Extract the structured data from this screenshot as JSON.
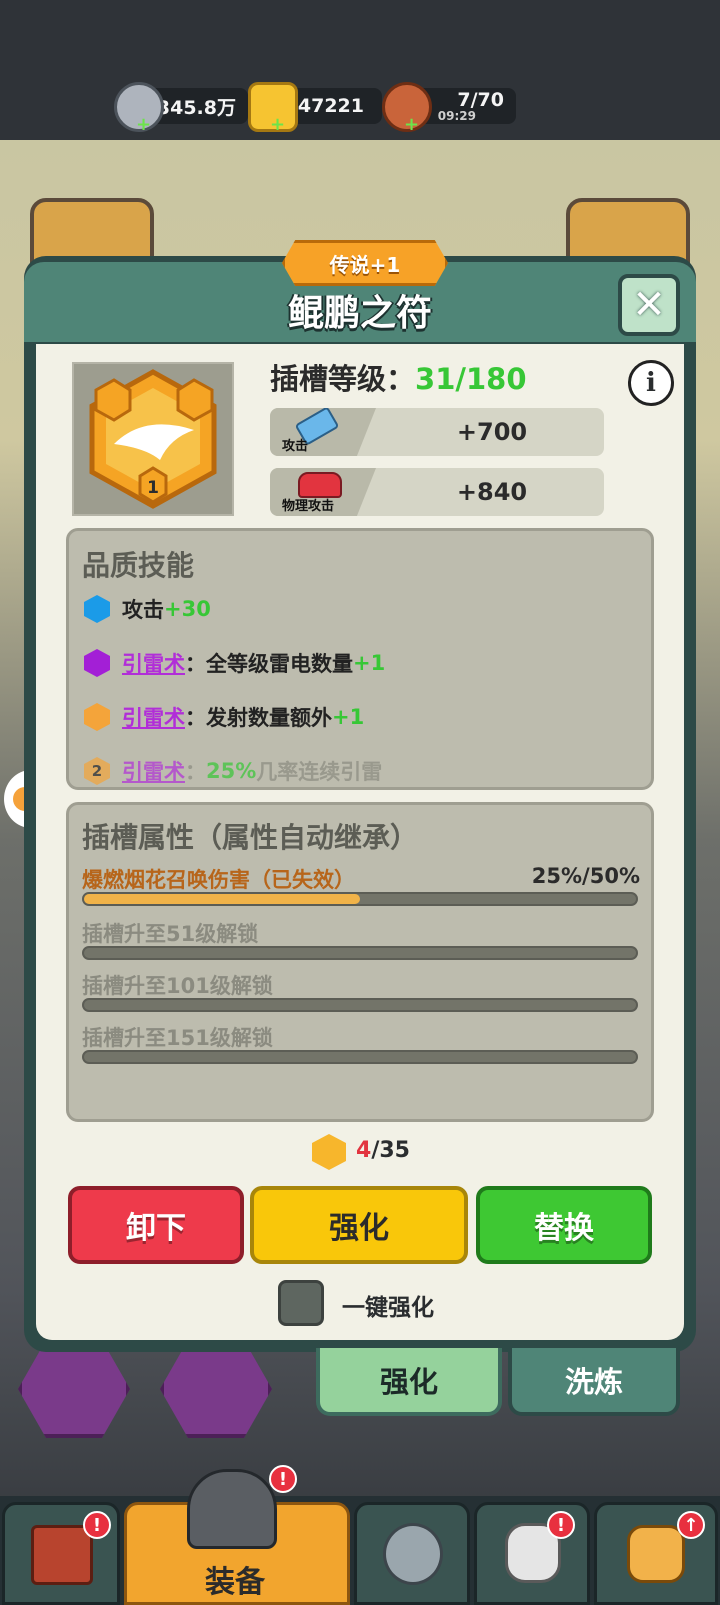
{
  "currency": {
    "silver": "3345.8万",
    "gold": "47221",
    "stamina": "7/70",
    "stamina_timer": "09:29",
    "add_symbol": "+"
  },
  "item": {
    "rarity": "传说+1",
    "name": "鲲鹏之符",
    "emblem_level": "1",
    "slot_level_label": "插槽等级：",
    "slot_level": "31/180",
    "info_symbol": "i",
    "stats": [
      {
        "name": "攻击",
        "value": "+700"
      },
      {
        "name": "物理攻击",
        "value": "+840"
      }
    ]
  },
  "quality_skills": {
    "title": "品质技能",
    "rows": [
      {
        "color": "#1b9be8",
        "plain": "攻击",
        "bonus": "+30"
      },
      {
        "color": "#a31fd6",
        "link": "引雷术",
        "text": "：全等级雷电数量",
        "bonus": "+1"
      },
      {
        "color": "#f4a43a",
        "link": "引雷术",
        "text": "：发射数量额外",
        "bonus": "+1"
      },
      {
        "color": "#f4a43a",
        "badge": "2",
        "link": "引雷术",
        "text": "：",
        "bonus": "25%",
        "tail": "几率连续引雷"
      }
    ]
  },
  "slot_attrs": {
    "title": "插槽属性（属性自动继承）",
    "active": {
      "label": "爆燃烟花召唤伤害",
      "status": "（已失效）",
      "value": "25%/50%",
      "progress": 0.5
    },
    "locked": [
      "插槽升至51级解锁",
      "插槽升至101级解锁",
      "插槽升至151级解锁"
    ]
  },
  "materials": {
    "owned": "4",
    "separator": "/",
    "required": "35"
  },
  "actions": {
    "unequip": "卸下",
    "enhance": "强化",
    "replace": "替换",
    "one_click": "一键强化"
  },
  "tabs": {
    "enhance": "强化",
    "refine": "洗炼"
  },
  "nav": {
    "equipment": "装备"
  },
  "colors": {
    "accent_green": "#37c736",
    "skill_link": "#b12ed8",
    "panel": "#bdbcae"
  }
}
